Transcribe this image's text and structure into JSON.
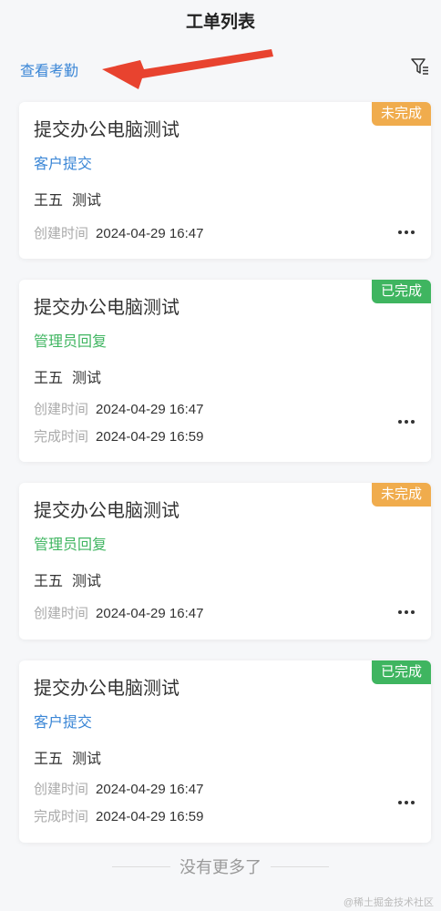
{
  "header": {
    "title": "工单列表"
  },
  "toolbar": {
    "attendance_label": "查看考勤"
  },
  "tickets": [
    {
      "status": "未完成",
      "title": "提交办公电脑测试",
      "source": "客户提交",
      "assignee_name": "王五",
      "assignee_note": "测试",
      "created_label": "创建时间",
      "created_time": "2024-04-29 16:47"
    },
    {
      "status": "已完成",
      "title": "提交办公电脑测试",
      "source": "管理员回复",
      "assignee_name": "王五",
      "assignee_note": "测试",
      "created_label": "创建时间",
      "created_time": "2024-04-29 16:47",
      "completed_label": "完成时间",
      "completed_time": "2024-04-29 16:59"
    },
    {
      "status": "未完成",
      "title": "提交办公电脑测试",
      "source": "管理员回复",
      "assignee_name": "王五",
      "assignee_note": "测试",
      "created_label": "创建时间",
      "created_time": "2024-04-29 16:47"
    },
    {
      "status": "已完成",
      "title": "提交办公电脑测试",
      "source": "客户提交",
      "assignee_name": "王五",
      "assignee_note": "测试",
      "created_label": "创建时间",
      "created_time": "2024-04-29 16:47",
      "completed_label": "完成时间",
      "completed_time": "2024-04-29 16:59"
    }
  ],
  "footer": {
    "no_more": "没有更多了"
  },
  "watermark": "@稀土掘金技术社区",
  "colors": {
    "accent_blue": "#3a86d6",
    "success_green": "#3fb560",
    "pending_orange": "#f0ac4d",
    "annotation_red": "#e8432f"
  },
  "icons": {
    "filter": "filter-icon",
    "more": "more-icon"
  }
}
